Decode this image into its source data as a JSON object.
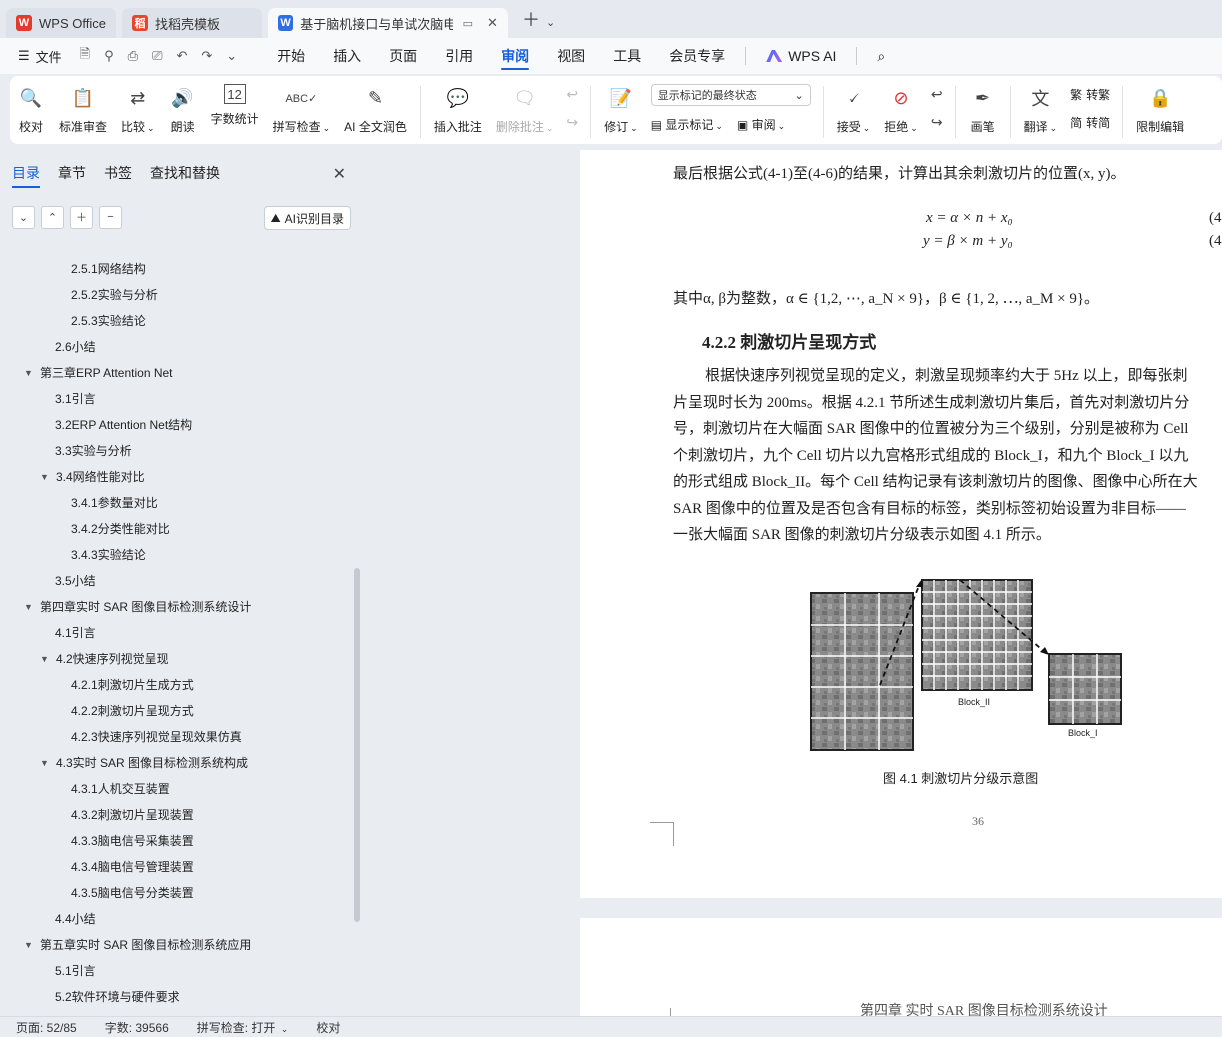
{
  "tabs": [
    {
      "label": "WPS Office",
      "logo": "W",
      "color": "#e23b2e"
    },
    {
      "label": "找稻壳模板",
      "logo": "稻",
      "color": "#e8452f"
    },
    {
      "label": "基于脑机接口与单试次脑电分",
      "logo": "W",
      "color": "#2f6fe4"
    }
  ],
  "menu": {
    "file": "文件",
    "items": [
      "开始",
      "插入",
      "页面",
      "引用",
      "审阅",
      "视图",
      "工具",
      "会员专享"
    ],
    "active": "审阅",
    "ai": "WPS AI"
  },
  "ribbon": {
    "proof": "校对",
    "standard": "标准审查",
    "compare": "比较",
    "read": "朗读",
    "wordcount": "字数统计",
    "spellcheck": "拼写检查",
    "ai_polish": "AI 全文润色",
    "insert_comment": "插入批注",
    "delete_comment": "删除批注",
    "revise": "修订",
    "markup_select": "显示标记的最终状态",
    "show_markup": "显示标记",
    "review": "审阅",
    "accept": "接受",
    "reject": "拒绝",
    "pen": "画笔",
    "translate": "翻译",
    "to_traditional": "转繁",
    "to_simplified": "转简",
    "restrict": "限制编辑"
  },
  "sidebar": {
    "tabs": [
      "目录",
      "章节",
      "书签",
      "查找和替换"
    ],
    "ai_toc": "AI识别目录",
    "toc": [
      {
        "label": "2.5.1网络结构",
        "level": 3
      },
      {
        "label": "2.5.2实验与分析",
        "level": 3
      },
      {
        "label": "2.5.3实验结论",
        "level": 3
      },
      {
        "label": "2.6小结",
        "level": 2
      },
      {
        "label": "第三章ERP Attention Net",
        "level": 1,
        "expand": true
      },
      {
        "label": "3.1引言",
        "level": 2
      },
      {
        "label": "3.2ERP Attention Net结构",
        "level": 2
      },
      {
        "label": "3.3实验与分析",
        "level": 2
      },
      {
        "label": "3.4网络性能对比",
        "level": 2,
        "expand": true
      },
      {
        "label": "3.4.1参数量对比",
        "level": 3
      },
      {
        "label": "3.4.2分类性能对比",
        "level": 3
      },
      {
        "label": "3.4.3实验结论",
        "level": 3
      },
      {
        "label": "3.5小结",
        "level": 2
      },
      {
        "label": "第四章实时 SAR 图像目标检测系统设计",
        "level": 1,
        "expand": true
      },
      {
        "label": "4.1引言",
        "level": 2
      },
      {
        "label": "4.2快速序列视觉呈现",
        "level": 2,
        "expand": true
      },
      {
        "label": "4.2.1刺激切片生成方式",
        "level": 3
      },
      {
        "label": "4.2.2刺激切片呈现方式",
        "level": 3
      },
      {
        "label": "4.2.3快速序列视觉呈现效果仿真",
        "level": 3
      },
      {
        "label": "4.3实时 SAR 图像目标检测系统构成",
        "level": 2,
        "expand": true
      },
      {
        "label": "4.3.1人机交互装置",
        "level": 3
      },
      {
        "label": "4.3.2刺激切片呈现装置",
        "level": 3
      },
      {
        "label": "4.3.3脑电信号采集装置",
        "level": 3
      },
      {
        "label": "4.3.4脑电信号管理装置",
        "level": 3
      },
      {
        "label": "4.3.5脑电信号分类装置",
        "level": 3
      },
      {
        "label": "4.4小结",
        "level": 2
      },
      {
        "label": "第五章实时 SAR 图像目标检测系统应用",
        "level": 1,
        "expand": true
      },
      {
        "label": "5.1引言",
        "level": 2
      },
      {
        "label": "5.2软件环境与硬件要求",
        "level": 2
      }
    ]
  },
  "document": {
    "line1": "最后根据公式(4-1)至(4-6)的结果，计算出其余刺激切片的位置(x, y)。",
    "eq1": "x = α × n + x₀",
    "eq2": "y = β × m + y₀",
    "eq_num": "(4",
    "line2": "其中α, β为整数，α ∈ {1,2, ⋯, a_N × 9}，β ∈ {1, 2, ⋯, a_M × 9}。",
    "heading": "4.2.2    刺激切片呈现方式",
    "para": [
      "根据快速序列视觉呈现的定义，刺激呈现频率约大于 5Hz 以上，即每张刺",
      "片呈现时长为 200ms。根据 4.2.1 节所述生成刺激切片集后，首先对刺激切片分",
      "号，刺激切片在大幅面 SAR 图像中的位置被分为三个级别，分别是被称为 Cell",
      "个刺激切片，九个 Cell 切片以九宫格形式组成的 Block_I，和九个 Block_I 以九",
      "的形式组成 Block_II。每个 Cell 结构记录有该刺激切片的图像、图像中心所在大",
      "SAR 图像中的位置及是否包含有目标的标签，类别标签初始设置为非目标——",
      "一张大幅面 SAR 图像的刺激切片分级表示如图 4.1 所示。"
    ],
    "fig_label_ii": "Block_II",
    "fig_label_i": "Block_I",
    "caption": "图 4.1 刺激切片分级示意图",
    "page_number": "36",
    "next_header": "第四章  实时 SAR 图像目标检测系统设计"
  },
  "status": {
    "page": "页面: 52/85",
    "words": "字数: 39566",
    "spell": "拼写检查: 打开",
    "proof": "校对"
  }
}
